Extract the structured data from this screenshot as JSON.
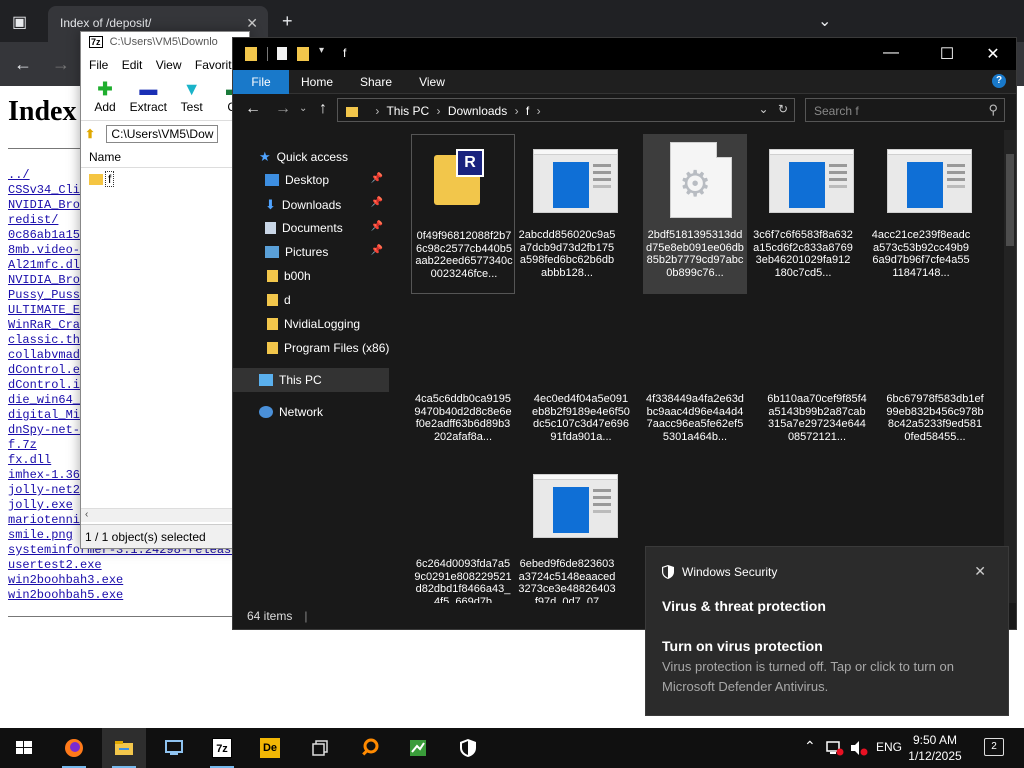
{
  "browser": {
    "tab_title": "Index of /deposit/",
    "page_heading": "Index",
    "links": [
      "../",
      "CSSv34_Cli",
      "NVIDIA_Bro",
      "redist/",
      "0c86ab1a15",
      "8mb.video-",
      "Al21mfc.dl",
      "NVIDIA_Bro",
      "Pussy_Puss",
      "ULTIMATE_E",
      "WinRaR_Cra",
      "classic.th",
      "collabvmad",
      "dControl.e",
      "dControl.i",
      "die_win64_",
      "digital_Mi",
      "dnSpy-net-",
      "f.7z",
      "fx.dll",
      "imhex-1.36",
      "jolly-net2",
      "jolly.exe",
      "mariotenni",
      "smile.png",
      "systeminformer-3.1.24298-release",
      "usertest2.exe",
      "win2boohbah3.exe",
      "win2boohbah5.exe"
    ]
  },
  "sevenzip": {
    "title": "C:\\Users\\VM5\\Downlo",
    "logo": "7z",
    "menu": [
      "File",
      "Edit",
      "View",
      "Favorite"
    ],
    "toolbar": {
      "add": "Add",
      "extract": "Extract",
      "test": "Test",
      "copy": "Co"
    },
    "path": "C:\\Users\\VM5\\Dow",
    "column_name": "Name",
    "item_name": "f",
    "status": "1 / 1 object(s) selected"
  },
  "explorer": {
    "title": "f",
    "ribbon": [
      "File",
      "Home",
      "Share",
      "View"
    ],
    "help": "?",
    "breadcrumb": [
      "This PC",
      "Downloads",
      "f"
    ],
    "search_placeholder": "Search f",
    "nav": {
      "quick_access": "Quick access",
      "desktop": "Desktop",
      "downloads": "Downloads",
      "documents": "Documents",
      "pictures": "Pictures",
      "b00h": "b00h",
      "d": "d",
      "nvidialogging": "NvidiaLogging",
      "program_files": "Program Files (x86)",
      "this_pc": "This PC",
      "network": "Network"
    },
    "files": [
      "0f49f96812088f2b76c98c2577cb440b5aab22eed6577340c0023246fce...",
      "2abcdd856020c9a5a7dcb9d73d2fb175a598fed6bc62b6dbabbb128...",
      "2bdf5181395313ddd75e8eb091ee06db85b2b7779cd97abc0b899c76...",
      "3c6f7c6f6583f8a632a15cd6f2c833a87693eb46201029fa912180c7cd5...",
      "4acc21ce239f8eadca573c53b92cc49b96a9d7b96f7cfe4a5511847148...",
      "4ca5c6ddb0ca91959470b40d2d8c8e6ef0e2adff63b6d89b3202afaf8a...",
      "4ec0ed4f04a5e091eb8b2f9189e4e6f50dc5c107c3d47e69691fda901a...",
      "4f338449a4fa2e63dbc9aac4d96e4a4d47aacc96ea5fe62ef55301a464b...",
      "6b110aa70cef9f85f4a5143b99b2a87cab315a7e297234e64408572121...",
      "6bc67978f583db1ef99eb832b456c978b8c42a5233f9ed5810fed58455...",
      "6c264d0093fda7a59c0291e808229521d82dbd1f8466a43_4f5_669d7b",
      "6ebed9f6de823603a3724c5148eaaced3273ce3e48826403f97d_0d7_07"
    ],
    "status_count": "64 items"
  },
  "toast": {
    "app": "Windows Security",
    "title": "Virus & threat protection",
    "heading": "Turn on virus protection",
    "body": "Virus protection is turned off. Tap or click to turn on Microsoft Defender Antivirus."
  },
  "taskbar": {
    "lang": "ENG",
    "time": "9:50 AM",
    "date": "1/12/2025",
    "notif_count": "2"
  }
}
